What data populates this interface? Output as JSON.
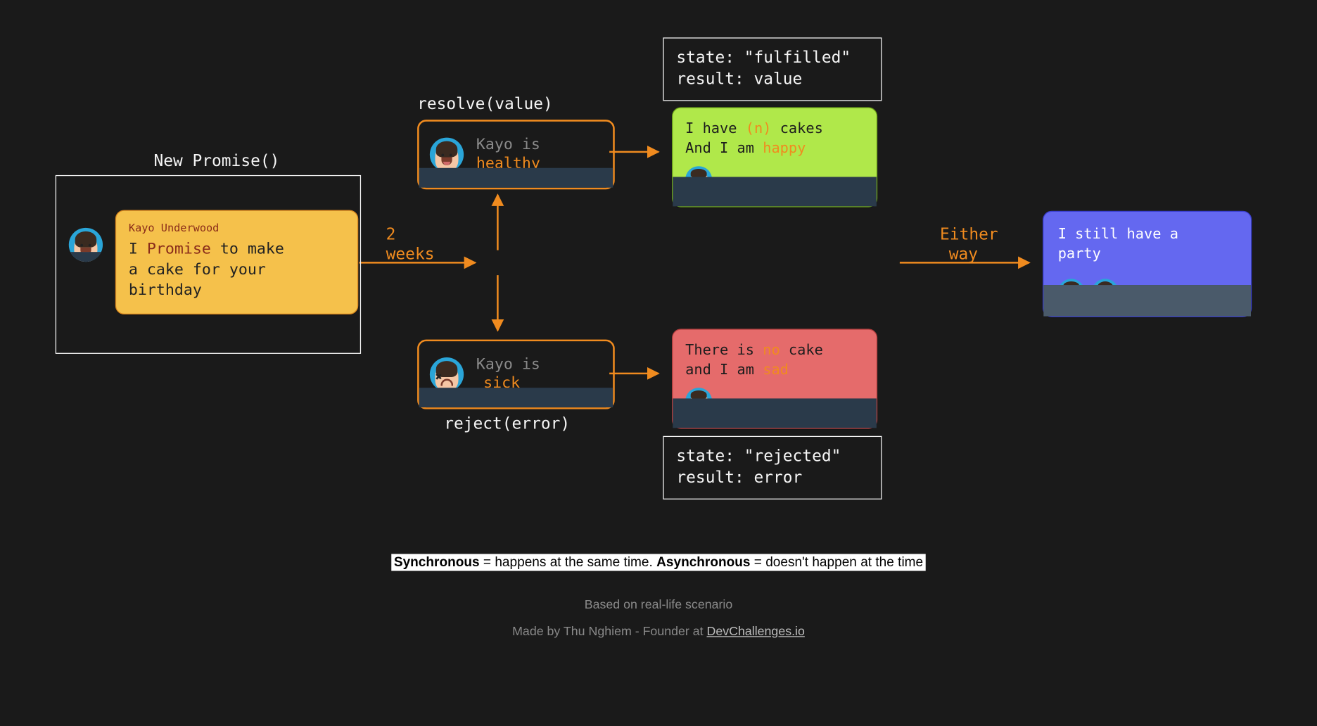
{
  "title": "New Promise()",
  "promise_card": {
    "author": "Kayo Underwood",
    "line1a": "I ",
    "line1_kw": "Promise",
    "line1b": " to make",
    "line2": "a cake for your",
    "line3": "birthday"
  },
  "time_label": {
    "l1": "2",
    "l2": "weeks"
  },
  "resolve_label": "resolve(value)",
  "reject_label": "reject(error)",
  "healthy": {
    "prefix": "Kayo is",
    "word": "healthy"
  },
  "sick": {
    "prefix": "Kayo is",
    "word": "sick"
  },
  "fulfilled_state": {
    "l1": "state: \"fulfilled\"",
    "l2": "result: value"
  },
  "rejected_state": {
    "l1": "state: \"rejected\"",
    "l2": "result: error"
  },
  "green_card": {
    "l1a": "I have ",
    "l1_kw": "(n)",
    "l1b": " cakes",
    "l2a": "And I am ",
    "l2_kw": "happy"
  },
  "red_card": {
    "l1a": "There is ",
    "l1_kw": "no",
    "l1b": " cake",
    "l2a": "and I am ",
    "l2_kw": "sad"
  },
  "either_label": {
    "l1": "Either",
    "l2": "way"
  },
  "blue_card": {
    "l1": "I still have a",
    "l2": "party"
  },
  "footer": {
    "defn_sync_label": "Synchronous",
    "defn_sync_text": " = happens at the same time. ",
    "defn_async_label": "Asynchronous",
    "defn_async_text": " = doesn't happen at the time",
    "based": "Based on real-life scenario",
    "made_prefix": "Made by Thu Nghiem - Founder at ",
    "made_link": "DevChallenges.io"
  }
}
